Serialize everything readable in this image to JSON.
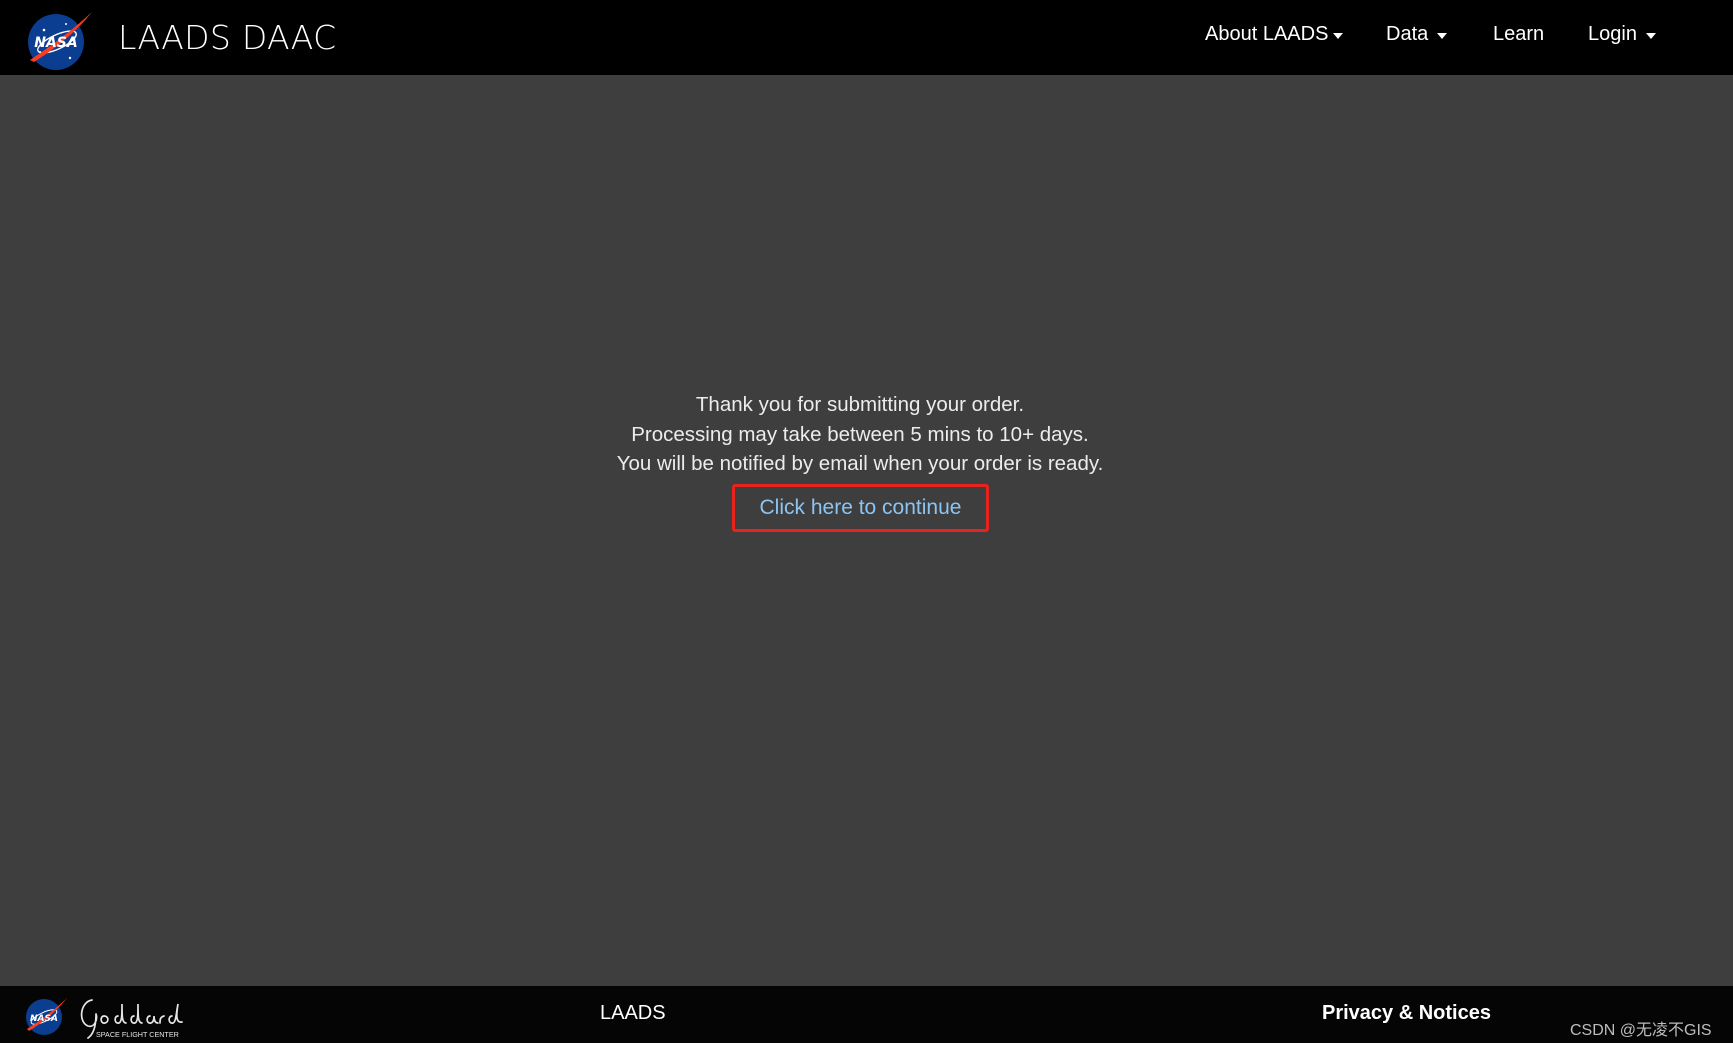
{
  "header": {
    "site_title": "LAADS DAAC",
    "nasa_logo_text": "NASA",
    "nav": [
      {
        "label": "About LAADS",
        "dropdown": true
      },
      {
        "label": "Data",
        "dropdown": true
      },
      {
        "label": "Learn",
        "dropdown": false
      },
      {
        "label": "Login",
        "dropdown": true
      }
    ]
  },
  "main": {
    "lines": [
      "Thank you for submitting your order.",
      "Processing may take between 5 mins to 10+ days.",
      "You will be notified by email when your order is ready."
    ],
    "continue_link": "Click here to continue",
    "highlight_color": "#e8221c",
    "link_color": "#8cc4f2"
  },
  "footer": {
    "goddard_sub": "SPACE FLIGHT CENTER",
    "laads_link": "LAADS",
    "privacy_link": "Privacy & Notices"
  },
  "watermark": "CSDN @无凌不GIS"
}
